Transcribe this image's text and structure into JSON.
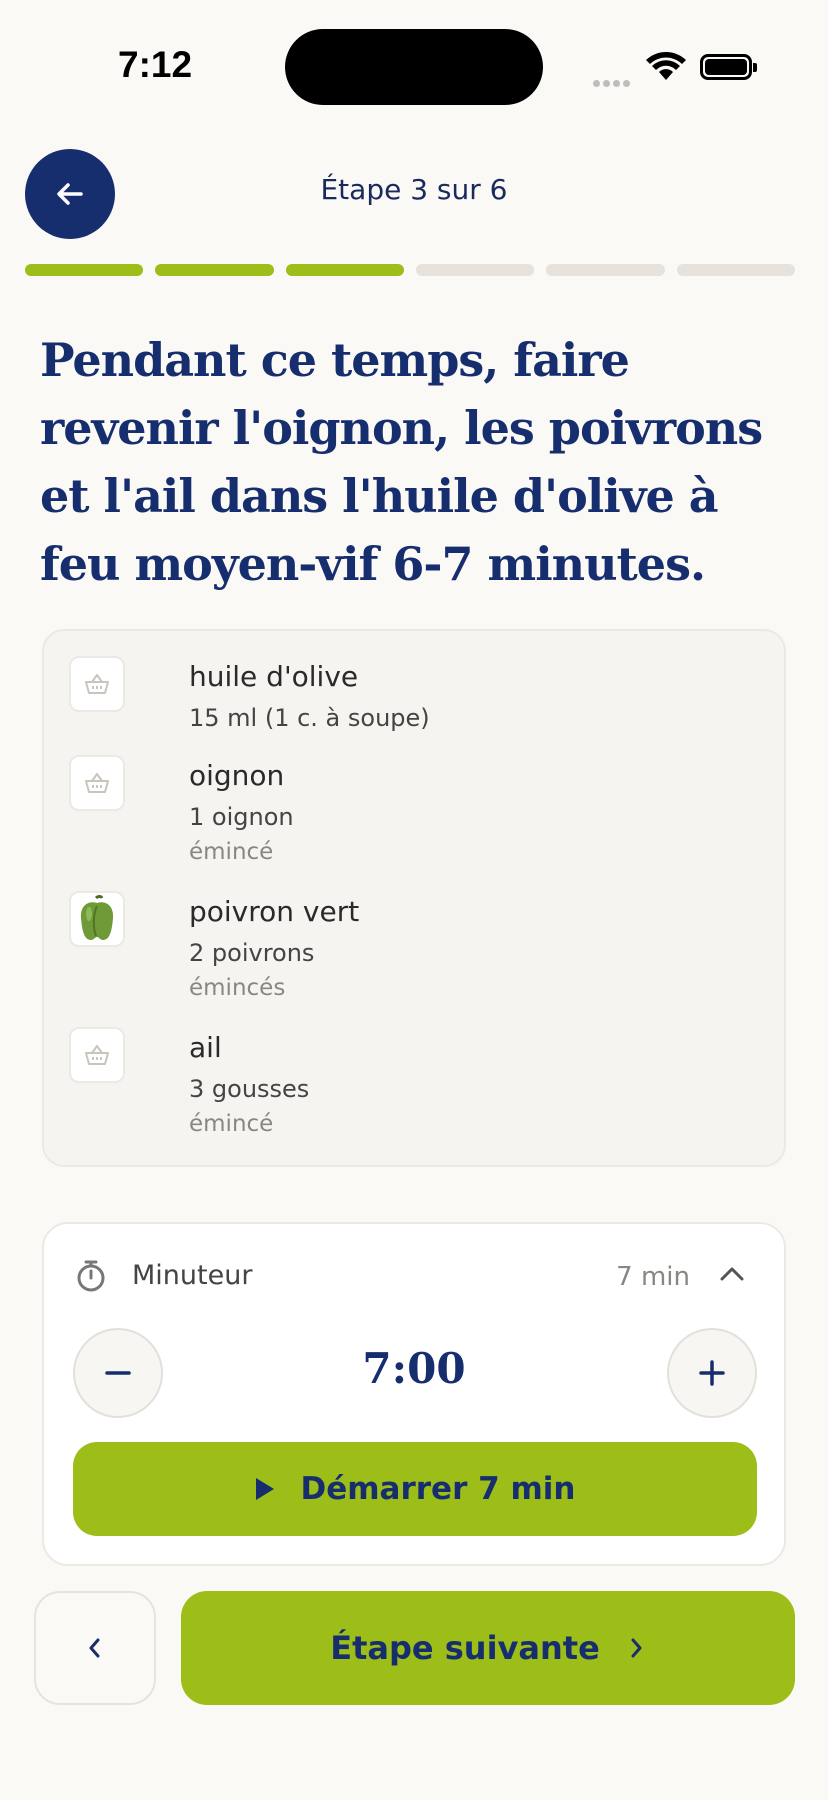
{
  "status_bar": {
    "time": "7:12"
  },
  "header": {
    "step_label": "Étape 3 sur 6"
  },
  "progress": {
    "total_steps": 6,
    "current_step": 3
  },
  "instruction": "Pendant ce temps, faire revenir l'oignon, les poivrons et l'ail dans l'huile d'olive à feu moyen-vif 6-7 minutes.",
  "ingredients": [
    {
      "name": "huile d'olive",
      "quantity": "15 ml (1 c. à soupe)",
      "note": "",
      "icon": "basket-icon"
    },
    {
      "name": "oignon",
      "quantity": "1 oignon",
      "note": "émincé",
      "icon": "basket-icon"
    },
    {
      "name": "poivron vert",
      "quantity": "2 poivrons",
      "note": "émincés",
      "icon": "green-pepper-icon"
    },
    {
      "name": "ail",
      "quantity": "3 gousses",
      "note": "émincé",
      "icon": "basket-icon"
    }
  ],
  "timer": {
    "label": "Minuteur",
    "summary": "7 min",
    "value": "7:00",
    "start_label": "Démarrer 7 min"
  },
  "footer": {
    "next_label": "Étape suivante"
  },
  "colors": {
    "navy": "#172e6e",
    "lime": "#9dbd19",
    "background": "#faf9f6"
  }
}
